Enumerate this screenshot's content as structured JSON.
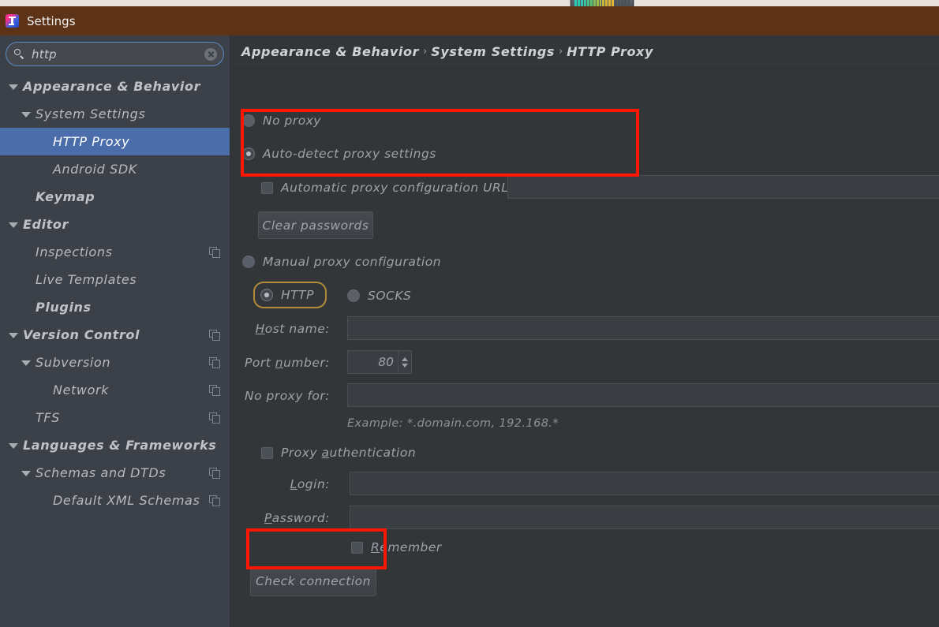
{
  "window": {
    "title": "Settings",
    "logo_icon": "intellij-idea-logo-icon",
    "titlebar_color": "#5c3317"
  },
  "overlay_widget": {
    "name": "segmented-level-meter",
    "segments": 14
  },
  "search": {
    "value": "http",
    "placeholder": "",
    "search_icon": "search-icon",
    "clear_icon": "close-circle-icon"
  },
  "sidebar": {
    "items": [
      {
        "label": "Appearance & Behavior",
        "indent": 0,
        "arrow": "down",
        "bold": true,
        "selected": false,
        "copy_icon": false
      },
      {
        "label": "System Settings",
        "indent": 1,
        "arrow": "down",
        "bold": false,
        "selected": false,
        "copy_icon": false
      },
      {
        "label": "HTTP Proxy",
        "indent": 2,
        "arrow": "none",
        "bold": false,
        "selected": true,
        "copy_icon": false
      },
      {
        "label": "Android SDK",
        "indent": 2,
        "arrow": "none",
        "bold": false,
        "selected": false,
        "copy_icon": false
      },
      {
        "label": "Keymap",
        "indent": 1,
        "arrow": "none",
        "bold": true,
        "selected": false,
        "copy_icon": false
      },
      {
        "label": "Editor",
        "indent": 0,
        "arrow": "down",
        "bold": true,
        "selected": false,
        "copy_icon": false
      },
      {
        "label": "Inspections",
        "indent": 1,
        "arrow": "none",
        "bold": false,
        "selected": false,
        "copy_icon": true
      },
      {
        "label": "Live Templates",
        "indent": 1,
        "arrow": "none",
        "bold": false,
        "selected": false,
        "copy_icon": false
      },
      {
        "label": "Plugins",
        "indent": 1,
        "arrow": "none",
        "bold": true,
        "selected": false,
        "copy_icon": false
      },
      {
        "label": "Version Control",
        "indent": 0,
        "arrow": "down",
        "bold": true,
        "selected": false,
        "copy_icon": true
      },
      {
        "label": "Subversion",
        "indent": 1,
        "arrow": "down",
        "bold": false,
        "selected": false,
        "copy_icon": true
      },
      {
        "label": "Network",
        "indent": 2,
        "arrow": "none",
        "bold": false,
        "selected": false,
        "copy_icon": true
      },
      {
        "label": "TFS",
        "indent": 1,
        "arrow": "none",
        "bold": false,
        "selected": false,
        "copy_icon": true
      },
      {
        "label": "Languages & Frameworks",
        "indent": 0,
        "arrow": "down",
        "bold": true,
        "selected": false,
        "copy_icon": false
      },
      {
        "label": "Schemas and DTDs",
        "indent": 1,
        "arrow": "down",
        "bold": false,
        "selected": false,
        "copy_icon": true
      },
      {
        "label": "Default XML Schemas",
        "indent": 2,
        "arrow": "none",
        "bold": false,
        "selected": false,
        "copy_icon": true
      }
    ],
    "selected_color": "#4b6eab"
  },
  "breadcrumb": {
    "items": [
      "Appearance & Behavior",
      "System Settings",
      "HTTP Proxy"
    ],
    "separator": "›"
  },
  "proxy_form": {
    "no_proxy": {
      "label": "No proxy",
      "checked": false
    },
    "auto_detect": {
      "label": "Auto-detect proxy settings",
      "checked": true
    },
    "auto_config_url": {
      "label": "Automatic proxy configuration URL:",
      "checked": false,
      "value": ""
    },
    "clear_passwords_button": "Clear passwords",
    "manual": {
      "label": "Manual proxy configuration",
      "checked": false
    },
    "protocol": {
      "http": {
        "label": "HTTP",
        "checked": true,
        "focused": true
      },
      "socks": {
        "label": "SOCKS",
        "checked": false
      }
    },
    "host_name": {
      "label": "Host name:",
      "mnemonic": "H",
      "value": ""
    },
    "port_number": {
      "label": "Port number:",
      "mnemonic": "n",
      "value": "80"
    },
    "no_proxy_for": {
      "label": "No proxy for:",
      "value": ""
    },
    "example_text": "Example: *.domain.com, 192.168.*",
    "proxy_authentication": {
      "label": "Proxy authentication",
      "mnemonic": "a",
      "checked": false
    },
    "login": {
      "label": "Login:",
      "mnemonic": "L",
      "value": ""
    },
    "password": {
      "label": "Password:",
      "mnemonic": "P",
      "value": ""
    },
    "remember": {
      "label": "Remember",
      "mnemonic": "R",
      "checked": false
    },
    "check_connection_button": "Check connection"
  },
  "annotations": {
    "highlight_color": "#ff1500",
    "boxes": [
      {
        "name": "auto-detect-section-highlight"
      },
      {
        "name": "check-connection-highlight"
      }
    ]
  }
}
